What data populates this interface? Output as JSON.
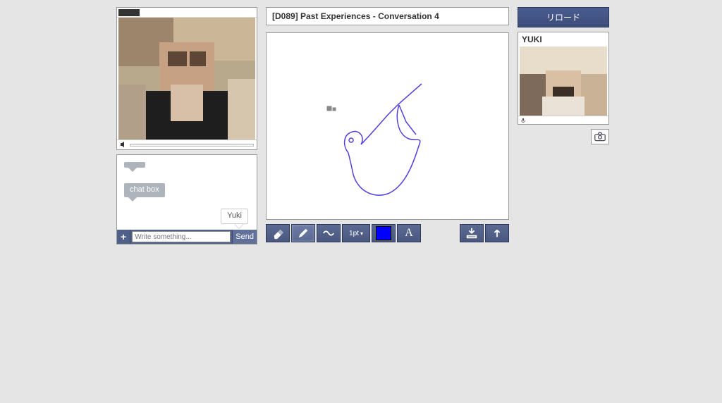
{
  "center": {
    "title": "[D089] Past Experiences - Conversation 4"
  },
  "chat": {
    "bubble1": "",
    "bubble2": "chat box",
    "bubble3": "Yuki",
    "input_placeholder": "Write something...",
    "send_label": "Send",
    "add_label": "+"
  },
  "whiteboard": {
    "stroke_label": "1pt",
    "stroke_arrow": "▾",
    "color": "#0000ff"
  },
  "right": {
    "reload_label": "リロード",
    "peer_name": "YUKI"
  }
}
